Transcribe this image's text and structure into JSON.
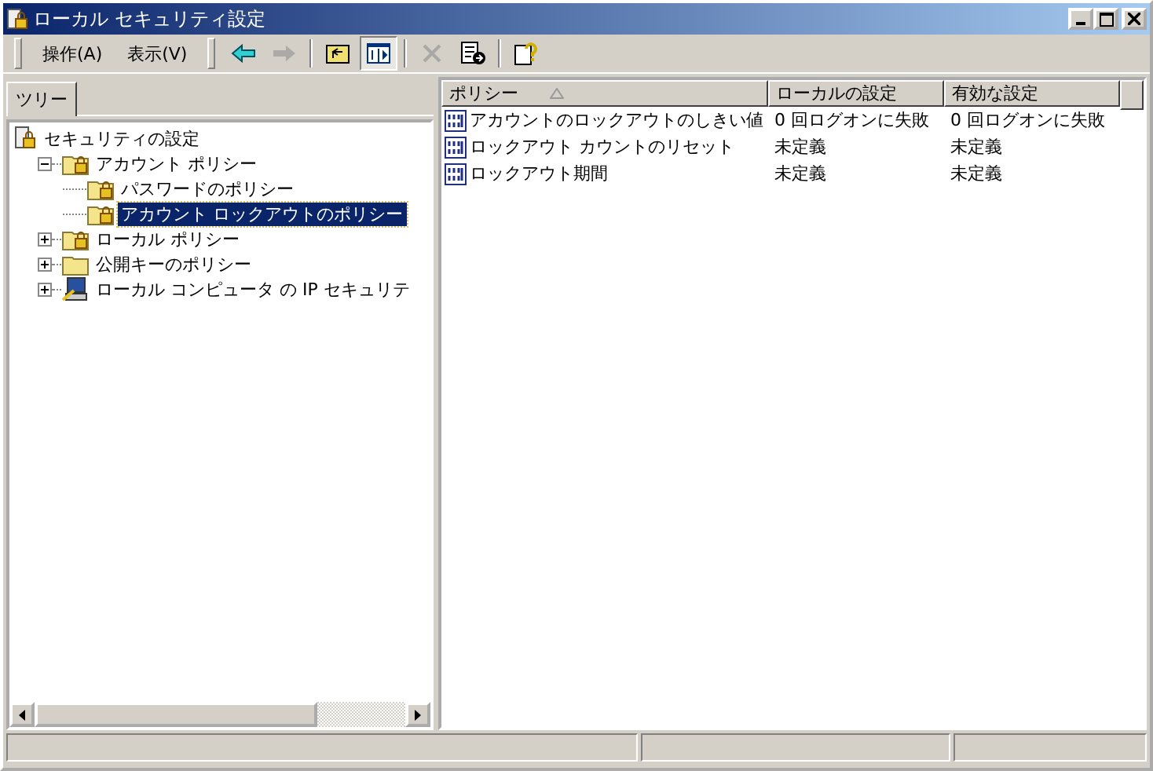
{
  "window": {
    "title": "ローカル セキュリティ設定"
  },
  "menu": [
    {
      "label": "操作(A)"
    },
    {
      "label": "表示(V)"
    }
  ],
  "toolbar": [
    {
      "kind": "back",
      "disabled": false,
      "pressed": false
    },
    {
      "kind": "forward",
      "disabled": true,
      "pressed": false
    },
    {
      "kind": "sep"
    },
    {
      "kind": "up",
      "disabled": false,
      "pressed": false
    },
    {
      "kind": "tree",
      "disabled": false,
      "pressed": true
    },
    {
      "kind": "sep"
    },
    {
      "kind": "delete",
      "disabled": true,
      "pressed": false
    },
    {
      "kind": "export",
      "disabled": false,
      "pressed": false
    },
    {
      "kind": "sep"
    },
    {
      "kind": "help",
      "disabled": false,
      "pressed": false
    }
  ],
  "tree_tab": {
    "label": "ツリー"
  },
  "tree": [
    {
      "label": "セキュリティの設定",
      "kind": "root",
      "selected": false,
      "children": [
        {
          "label": "アカウント ポリシー",
          "kind": "lockfolder",
          "expanded": true,
          "selected": false,
          "children": [
            {
              "label": "パスワードのポリシー",
              "kind": "lockfolder",
              "selected": false
            },
            {
              "label": "アカウント ロックアウトのポリシー",
              "kind": "lockfolder",
              "selected": true
            }
          ]
        },
        {
          "label": "ローカル ポリシー",
          "kind": "lockfolder",
          "expanded": false,
          "selected": false
        },
        {
          "label": "公開キーのポリシー",
          "kind": "folder",
          "expanded": false,
          "selected": false
        },
        {
          "label": "ローカル コンピュータ の IP セキュリテ",
          "kind": "computer",
          "expanded": false,
          "selected": false
        }
      ]
    }
  ],
  "table": {
    "columns": [
      {
        "label": "ポリシー",
        "sorted": true
      },
      {
        "label": "ローカルの設定",
        "sorted": false
      },
      {
        "label": "有効な設定",
        "sorted": false
      }
    ],
    "rows": [
      {
        "cells": [
          "アカウントのロックアウトのしきい値",
          "0 回ログオンに失敗",
          "0 回ログオンに失敗"
        ]
      },
      {
        "cells": [
          "ロックアウト カウントのリセット",
          "未定義",
          "未定義"
        ]
      },
      {
        "cells": [
          "ロックアウト期間",
          "未定義",
          "未定義"
        ]
      }
    ]
  }
}
